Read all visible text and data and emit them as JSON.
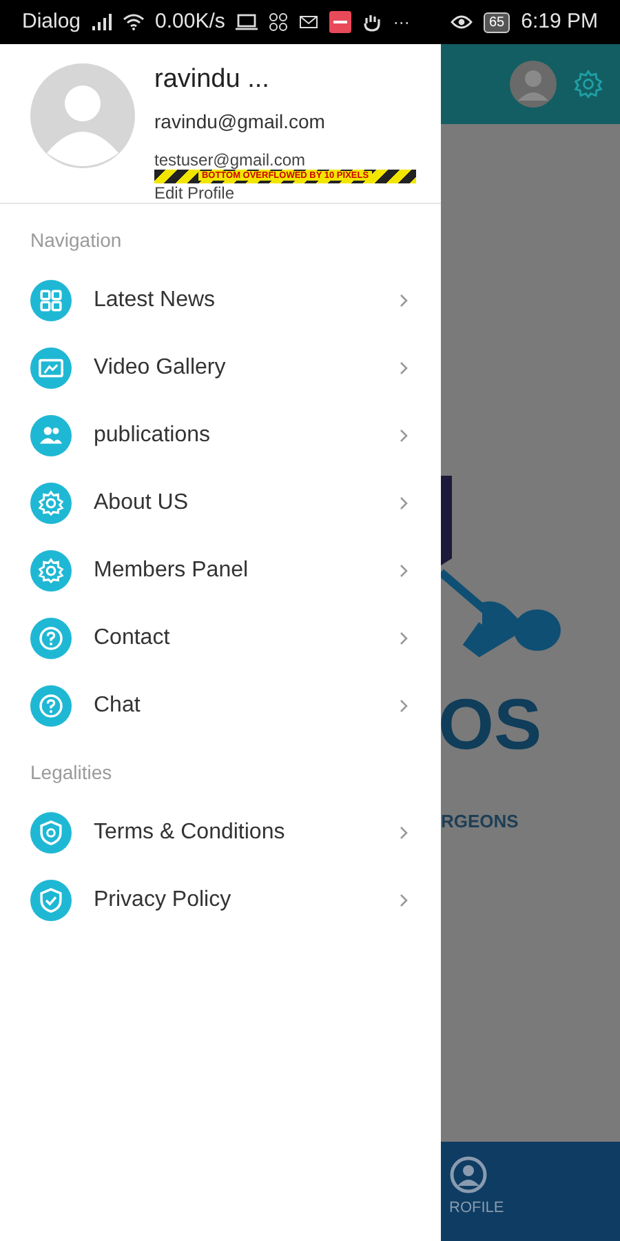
{
  "status_bar": {
    "carrier": "Dialog",
    "speed": "0.00K/s",
    "more": "···",
    "battery": "65",
    "time": "6:19 PM"
  },
  "drawer": {
    "profile": {
      "name": "ravindu ...",
      "email": "ravindu@gmail.com",
      "secondary_email": "testuser@gmail.com",
      "overflow_warning": "BOTTOM OVERFLOWED BY 10 PIXELS",
      "edit_link": "Edit Profile"
    },
    "sections": [
      {
        "title": "Navigation",
        "items": [
          {
            "label": "Latest News",
            "kind": "grid"
          },
          {
            "label": "Video Gallery",
            "kind": "gallery"
          },
          {
            "label": "publications",
            "kind": "people"
          },
          {
            "label": "About US",
            "kind": "gear"
          },
          {
            "label": "Members Panel",
            "kind": "gear"
          },
          {
            "label": "Contact",
            "kind": "help"
          },
          {
            "label": "Chat",
            "kind": "help"
          }
        ]
      },
      {
        "title": "Legalities",
        "items": [
          {
            "label": "Terms & Conditions",
            "kind": "shield"
          },
          {
            "label": "Privacy Policy",
            "kind": "check"
          }
        ]
      }
    ]
  },
  "background": {
    "logo_text": "OS",
    "tagline": "RGEONS",
    "nav_label": "ROFILE"
  }
}
